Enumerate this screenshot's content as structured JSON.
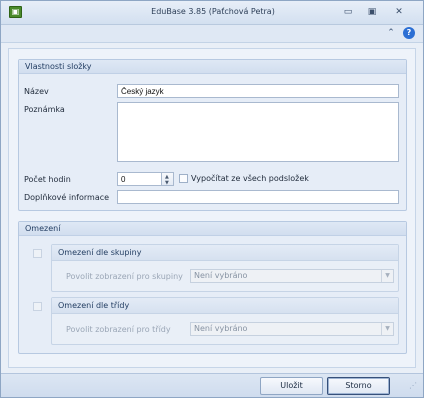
{
  "window": {
    "title": "EduBase 3.85 (Paťchová Petra)",
    "app_icon_glyph": "▣",
    "controls": {
      "minimize": "▭",
      "maximize": "▣",
      "close": "✕"
    }
  },
  "ribbon": {
    "collapse_glyph": "⌃",
    "help_glyph": "?"
  },
  "properties": {
    "header": "Vlastnosti složky",
    "name_label": "Název",
    "name_value": "Český jazyk",
    "note_label": "Poznámka",
    "note_value": "",
    "hours_label": "Počet hodin",
    "hours_value": "0",
    "spin_up": "▲",
    "spin_down": "▼",
    "calc_checkbox_label": "Vypočítat ze všech podsložek",
    "calc_checked": false,
    "extra_label": "Doplňkové informace",
    "extra_value": ""
  },
  "restrictions": {
    "header": "Omezení",
    "by_group": {
      "header": "Omezení dle skupiny",
      "enabled": false,
      "field_label": "Povolit zobrazení pro skupiny",
      "combo_value": "Není vybráno",
      "combo_arrow": "▼"
    },
    "by_class": {
      "header": "Omezení dle třídy",
      "enabled": false,
      "field_label": "Povolit zobrazení pro třídy",
      "combo_value": "Není vybráno",
      "combo_arrow": "▼"
    }
  },
  "footer": {
    "save_label": "Uložit",
    "cancel_label": "Storno",
    "grip_glyph": "⋰"
  }
}
